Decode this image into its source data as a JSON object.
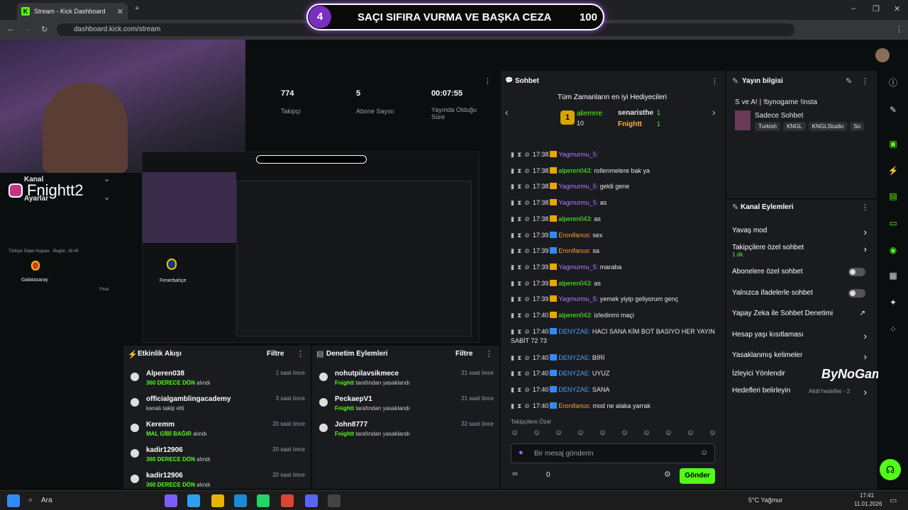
{
  "browser": {
    "tab_title": "Stream - Kick Dashboard",
    "url": "dashboard.kick.com/stream"
  },
  "banner": {
    "number": "4",
    "title": "SAÇI SIFIRA VURMA VE BAŞKA CEZA",
    "value": "100"
  },
  "overlay": {
    "handle": "Fnightt2"
  },
  "sidebar": {
    "kanal": "Kanal",
    "ayarlar": "Ayarlar",
    "match_info": "Türkiye Süper Kupası · Bugün, 18:45",
    "team1": "Galatasaray",
    "team2": "Fenerbahçe",
    "stage": "Final"
  },
  "stats": [
    {
      "value": "774",
      "label": "Takipçi"
    },
    {
      "value": "5",
      "label": "Abone Sayısı"
    },
    {
      "value": "00:07:55",
      "label": "Yayında Olduğu Süre"
    }
  ],
  "chat": {
    "title": "Sohbet",
    "gifters_title": "Tüm Zamanların en iyi Hediyecileri",
    "gifters": [
      {
        "rank": "1",
        "name": "aliemrre",
        "count": "10"
      },
      {
        "name": "senaristhe",
        "count": "1"
      },
      {
        "name": "Fnightt",
        "count": "1"
      }
    ],
    "messages": [
      {
        "time": "17:38",
        "user": "Yagmurmu_5:",
        "text": "",
        "color": "#b57cff"
      },
      {
        "time": "17:38",
        "user": "alperen043:",
        "text": "rollenmelere bak ya",
        "color": "#53fc18"
      },
      {
        "time": "17:38",
        "user": "Yagmurmu_5:",
        "text": "geldi gene",
        "color": "#b57cff"
      },
      {
        "time": "17:38",
        "user": "Yagmurmu_5:",
        "text": "as",
        "color": "#b57cff"
      },
      {
        "time": "17:38",
        "user": "alperen043:",
        "text": "as",
        "color": "#53fc18"
      },
      {
        "time": "17:39",
        "user": "Eronifanus:",
        "text": "sex",
        "color": "#ff9d3a"
      },
      {
        "time": "17:39",
        "user": "Eronifanus:",
        "text": "sa",
        "color": "#ff9d3a"
      },
      {
        "time": "17:39",
        "user": "Yagmurmu_5:",
        "text": "maraba",
        "color": "#b57cff"
      },
      {
        "time": "17:39",
        "user": "alperen043:",
        "text": "as",
        "color": "#53fc18"
      },
      {
        "time": "17:39",
        "user": "Yagmurmu_5:",
        "text": "yemek yiyip geliyorum genç",
        "color": "#b57cff"
      },
      {
        "time": "17:40",
        "user": "alperen043:",
        "text": "izledinmi maçi",
        "color": "#53fc18"
      },
      {
        "time": "17:40",
        "user": "DENYZAE:",
        "text": "HACI SANA KİM BOT BASIYO HER YAYIN SABİT 72 73",
        "color": "#4aa3ff"
      },
      {
        "time": "17:40",
        "user": "DENYZAE:",
        "text": "BİRİ",
        "color": "#4aa3ff"
      },
      {
        "time": "17:40",
        "user": "DENYZAE:",
        "text": "UYUZ",
        "color": "#4aa3ff"
      },
      {
        "time": "17:40",
        "user": "DENYZAE:",
        "text": "SANA",
        "color": "#4aa3ff"
      },
      {
        "time": "17:40",
        "user": "Eronifanus:",
        "text": "mod ne alaka yarrak",
        "color": "#ff9d3a"
      }
    ],
    "followers_only": "Takipçilere Özel",
    "input_placeholder": "Bir mesaj gönderin",
    "points": "0",
    "send_label": "Gönder"
  },
  "stream_info": {
    "title": "Yayın bilgisi",
    "stream_title": "S ve A! | !bynogame !insta",
    "category": "Sadece Sohbet",
    "tags": [
      "Turkish",
      "KNGL",
      "KNGLStudio",
      "So"
    ]
  },
  "channel_actions": {
    "title": "Kanal Eylemleri",
    "items": [
      {
        "label": "Yavaş mod",
        "control": "chevron"
      },
      {
        "label": "Takipçilere özel sohbet",
        "sub": "1 dk.",
        "control": "chevron"
      },
      {
        "label": "Abonelere özel sohbet",
        "control": "toggle"
      },
      {
        "label": "Yalnızca ifadelerle sohbet",
        "control": "toggle"
      },
      {
        "label": "Yapay Zeka ile Sohbet Denetimi",
        "control": "external"
      },
      {
        "label": "Hesap yaşı kısıtlaması",
        "control": "chevron"
      },
      {
        "label": "Yasaklanmış kelimeler",
        "control": "chevron"
      },
      {
        "label": "İzleyici Yönlendir",
        "control": "none"
      },
      {
        "label": "Hedefleri belirleyin",
        "sub": "Aktif hedefler - 2",
        "control": "chevron"
      }
    ],
    "watermark": "ByNoGame"
  },
  "activity": {
    "title": "Etkinlik Akışı",
    "filter": "Filtre",
    "items": [
      {
        "name": "Alperen038",
        "sub": "360 DERECE DÖN",
        "sub2": "alındı",
        "time": "1 saat önce"
      },
      {
        "name": "officialgamblingacademy",
        "sub": "",
        "sub2": "kanalı takip etti",
        "time": "3 saat önce"
      },
      {
        "name": "Keremm",
        "sub": "MAL GİBİ BAĞIR",
        "sub2": "alındı",
        "time": "20 saat önce"
      },
      {
        "name": "kadir12906",
        "sub": "360 DERECE DÖN",
        "sub2": "alındı",
        "time": "20 saat önce"
      },
      {
        "name": "kadir12906",
        "sub": "360 DERECE DÖN",
        "sub2": "alındı",
        "time": "20 saat önce"
      }
    ]
  },
  "moderation": {
    "title": "Denetim Eylemleri",
    "filter": "Filtre",
    "items": [
      {
        "name": "nohutpilavsikmece",
        "by": "Fnightt",
        "action": "tarafından yasaklandı",
        "time": "21 saat önce"
      },
      {
        "name": "PeckaepV1",
        "by": "Fnightt",
        "action": "tarafından yasaklandı",
        "time": "21 saat önce"
      },
      {
        "name": "John8777",
        "by": "Fnightt",
        "action": "tarafından yasaklandı",
        "time": "22 saat önce"
      }
    ]
  },
  "taskbar": {
    "search": "Ara",
    "weather": "5°C Yağmur",
    "time": "17:41",
    "date": "11.01.2026"
  },
  "colors": {
    "accent": "#53fc18",
    "panel": "#191b1f",
    "bg": "#0b0e0f"
  }
}
